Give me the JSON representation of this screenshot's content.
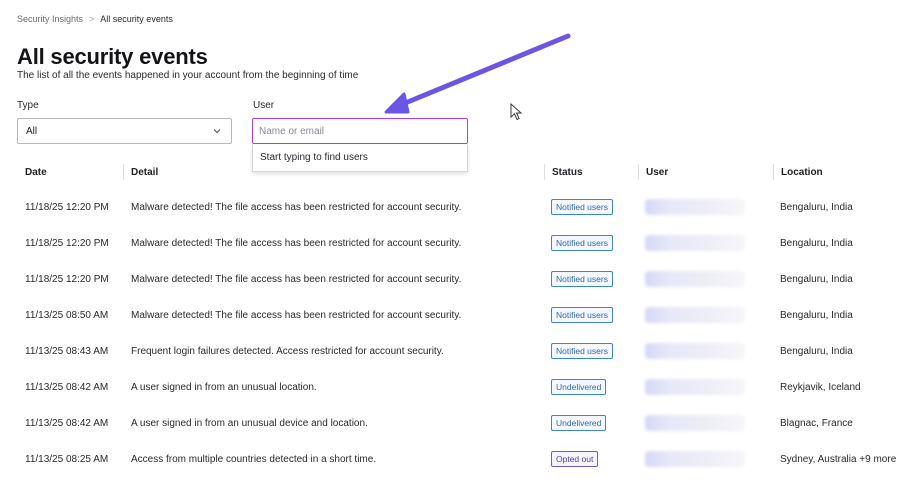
{
  "breadcrumb": {
    "parent": "Security Insights",
    "separator": ">",
    "current": "All security events"
  },
  "header": {
    "title": "All security events",
    "subtitle": "The list of all the events happened in your account from the beginning of time"
  },
  "filters": {
    "type_label": "Type",
    "type_value": "All",
    "user_label": "User",
    "user_placeholder": "Name or email",
    "user_value": "",
    "user_dropdown_hint": "Start typing to find users"
  },
  "colors": {
    "focus_border": "#b23be0",
    "annotation_arrow": "#6a55e6",
    "badge_blue": "#3f86c8",
    "badge_purple": "#6a5bd6"
  },
  "icons": [
    "chevron-down-icon",
    "annotation-arrow-icon",
    "mouse-cursor-icon"
  ],
  "table": {
    "columns": [
      "Date",
      "Detail",
      "Status",
      "User",
      "Location"
    ],
    "rows": [
      {
        "date": "11/18/25 12:20 PM",
        "detail": "Malware detected! The file access has been restricted for account security.",
        "status": "Notified users",
        "status_kind": "blue",
        "location": "Bengaluru, India"
      },
      {
        "date": "11/18/25 12:20 PM",
        "detail": "Malware detected! The file access has been restricted for account security.",
        "status": "Notified users",
        "status_kind": "blue",
        "location": "Bengaluru, India"
      },
      {
        "date": "11/18/25 12:20 PM",
        "detail": "Malware detected! The file access has been restricted for account security.",
        "status": "Notified users",
        "status_kind": "blue",
        "location": "Bengaluru, India"
      },
      {
        "date": "11/13/25 08:50 AM",
        "detail": "Malware detected! The file access has been restricted for account security.",
        "status": "Notified users",
        "status_kind": "blue",
        "location": "Bengaluru, India"
      },
      {
        "date": "11/13/25 08:43 AM",
        "detail": "Frequent login failures detected. Access restricted for account security.",
        "status": "Notified users",
        "status_kind": "blue",
        "location": "Bengaluru, India"
      },
      {
        "date": "11/13/25 08:42 AM",
        "detail": "A user signed in from an unusual location.",
        "status": "Undelivered",
        "status_kind": "blue",
        "location": "Reykjavik, Iceland"
      },
      {
        "date": "11/13/25 08:42 AM",
        "detail": "A user signed in from an unusual device and location.",
        "status": "Undelivered",
        "status_kind": "blue",
        "location": "Blagnac, France"
      },
      {
        "date": "11/13/25 08:25 AM",
        "detail": "Access from multiple countries detected in a short time.",
        "status": "Opted out",
        "status_kind": "purple",
        "location": "Sydney, Australia +9 more"
      }
    ]
  }
}
